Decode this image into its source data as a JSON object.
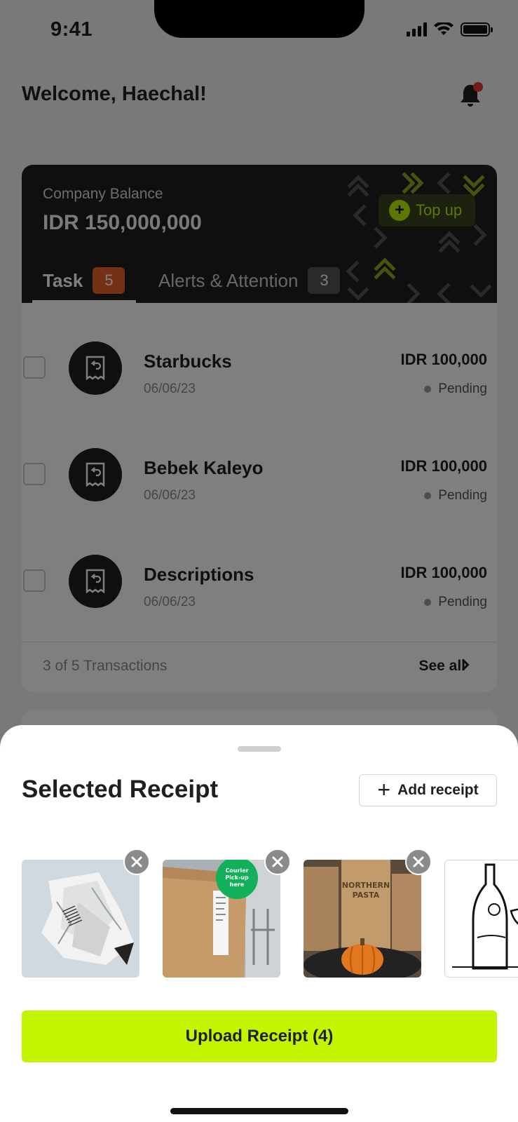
{
  "status_bar": {
    "time": "9:41"
  },
  "header": {
    "welcome": "Welcome, Haechal!"
  },
  "balance_card": {
    "label": "Company Balance",
    "value": "IDR 150,000,000",
    "topup_label": "Top up",
    "tabs": [
      {
        "label": "Task",
        "count": "5",
        "active": true
      },
      {
        "label": "Alerts & Attention",
        "count": "3",
        "active": false
      }
    ],
    "transactions": [
      {
        "name": "Starbucks",
        "date": "06/06/23",
        "amount": "IDR 100,000",
        "status": "Pending"
      },
      {
        "name": "Bebek Kaleyo",
        "date": "06/06/23",
        "amount": "IDR 100,000",
        "status": "Pending"
      },
      {
        "name": "Descriptions",
        "date": "06/06/23",
        "amount": "IDR 100,000",
        "status": "Pending"
      }
    ],
    "footer_count": "3 of 5 Transactions",
    "see_all": "See all"
  },
  "sheet": {
    "title": "Selected Receipt",
    "add_label": "Add receipt",
    "upload_label": "Upload Receipt (4)",
    "thumbnails": [
      {
        "icon": "crumpled-receipt-photo",
        "sticker_text": ""
      },
      {
        "icon": "paper-bag-photo",
        "sticker_text": "Courier Pick-up here"
      },
      {
        "icon": "pasta-bags-photo",
        "sticker_text": "NORTHERN PASTA"
      },
      {
        "icon": "bottle-sketch-photo",
        "sticker_text": ""
      }
    ]
  },
  "colors": {
    "accent": "#c3f400",
    "badge_orange": "#e8622a",
    "card_dark": "#1f1f1f",
    "notification": "#e53935"
  }
}
